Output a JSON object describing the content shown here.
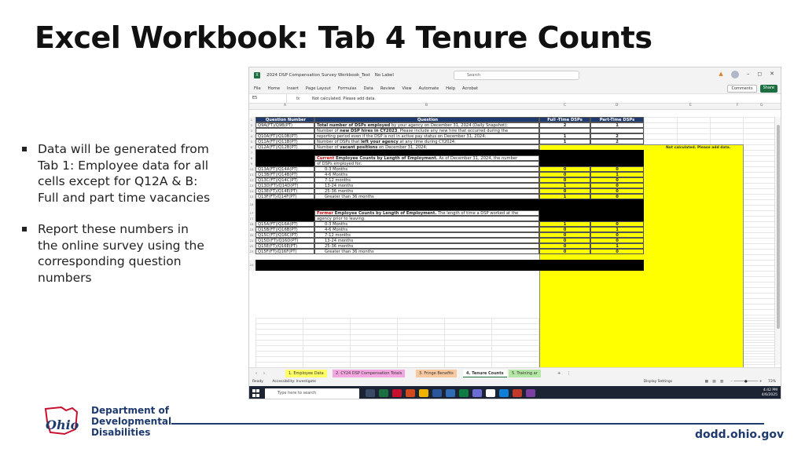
{
  "slide": {
    "title": "Excel Workbook: Tab 4 Tenure Counts",
    "bullets": [
      "Data will be generated from Tab 1: Employee data for all cells except for Q12A & B: Full and part time vacancies",
      "Report these numbers in the online survey using the corresponding question numbers"
    ]
  },
  "excel": {
    "file_title": "2024 DSP Compensation Survey Workbook_Test",
    "label": "No Label",
    "search_placeholder": "Search",
    "menu": [
      "File",
      "Home",
      "Insert",
      "Page Layout",
      "Formulas",
      "Data",
      "Review",
      "View",
      "Automate",
      "Help",
      "Acrobat"
    ],
    "comments_label": "Comments",
    "share_label": "Share",
    "name_box": "E5",
    "formula_value": "Not calculated. Please add data.",
    "columns": [
      "A",
      "B",
      "C",
      "D",
      "E",
      "F",
      "G"
    ],
    "header": {
      "q": "Question Number",
      "question": "Question",
      "ft": "Full -Time DSPs",
      "pt": "Part-Time DSPs"
    },
    "rows1": [
      {
        "rn": "2",
        "q": "Q9A(FT)/Q9B(PT)",
        "pre": "",
        "bold": "Total number of DSPs employed",
        "post": " by your agency on December 31, 2024 (Daily Snapshot):",
        "ft": "2",
        "pt": "1"
      },
      {
        "rn": "3",
        "q": "",
        "pre": "Number of ",
        "bold": "new DSP hires in CY2023",
        "post": ". Please include any new hire that occurred during the",
        "ft": "",
        "pt": ""
      },
      {
        "rn": "4",
        "q": "Q10A(FT)/Q10B(PT)",
        "pre": "reporting period even if the DSP is not in active pay status on December 31, 2024:",
        "bold": "",
        "post": "",
        "ft": "1",
        "pt": "2"
      },
      {
        "rn": "5",
        "q": "Q11A(FT)/Q11B(PT)",
        "pre": "Number of DSPs that ",
        "bold": "left your agency",
        "post": " at any time during CY2024:",
        "ft": "1",
        "pt": "2"
      },
      {
        "rn": "6",
        "q": "Q12A(FT)/Q12B(PT)",
        "pre": "Number of ",
        "bold": "vacant positions",
        "post": " on December 31, 2024:",
        "ft": "",
        "pt": ""
      }
    ],
    "vacant_note": "Not calculated. Please add data.",
    "current_heading": {
      "red": "Current",
      "bold": " Employee Counts by Length of Employment.",
      "post": " As of December 31, 2024, the number",
      "line2": "of DSPs employed for:"
    },
    "current_rows": [
      {
        "rn": "10",
        "q": "Q13A(FT)/Q14A(PT)",
        "label": "0-3 Months",
        "ft": "0",
        "pt": "0"
      },
      {
        "rn": "11",
        "q": "Q13B(FT)/Q14B(PT)",
        "label": "4-6 Months",
        "ft": "0",
        "pt": "1"
      },
      {
        "rn": "12",
        "q": "Q13C(FT)/Q14C(PT)",
        "label": "7-12 months",
        "ft": "0",
        "pt": "0"
      },
      {
        "rn": "13",
        "q": "Q13D(FT)/Q14D(PT)",
        "label": "13-24 months",
        "ft": "1",
        "pt": "0"
      },
      {
        "rn": "14",
        "q": "Q13E(FT)/Q14E(PT)",
        "label": "25-36 months",
        "ft": "0",
        "pt": "0"
      },
      {
        "rn": "15",
        "q": "Q13F(FT)/Q14F(PT)",
        "label": "Greater than 36 months",
        "ft": "1",
        "pt": "0"
      }
    ],
    "former_heading": {
      "red": "Former",
      "bold": " Employee Counts by Length of Employment.",
      "post": " The length of time a DSP worked at the",
      "line2": "agency prior to leaving:"
    },
    "former_rows": [
      {
        "rn": "18",
        "q": "Q15A(FT)/Q16A(PT)",
        "label": "0-3 Months",
        "ft": "1",
        "pt": "0"
      },
      {
        "rn": "19",
        "q": "Q15B(FT)/Q16B(PT)",
        "label": "4-6 Months",
        "ft": "0",
        "pt": "1"
      },
      {
        "rn": "20",
        "q": "Q15C(FT)/Q16C(PT)",
        "label": "7-12 months",
        "ft": "0",
        "pt": "0"
      },
      {
        "rn": "21",
        "q": "Q15D(FT)/Q16D(PT)",
        "label": "13-24 months",
        "ft": "0",
        "pt": "0"
      },
      {
        "rn": "22",
        "q": "Q15E(FT)/Q16E(PT)",
        "label": "25-36 months",
        "ft": "0",
        "pt": "1"
      },
      {
        "rn": "23",
        "q": "Q15F(FT)/Q16F(PT)",
        "label": "Greater than 36 months",
        "ft": "0",
        "pt": "0"
      }
    ],
    "sheet_tabs": [
      {
        "label": "1. Employee Data",
        "color": "#ffff66"
      },
      {
        "label": "2. CY24 DSP Compensation Totals",
        "color": "#f4a6e0"
      },
      {
        "label": "3. Fringe Benefits",
        "color": "#f8c9a0"
      },
      {
        "label": "4. Tenure Counts",
        "color": "#ffffff"
      },
      {
        "label": "5. Training ar",
        "color": "#b6e6a6"
      }
    ],
    "status_left": "Ready",
    "accessibility": "Accessibility: Investigate",
    "display_settings": "Display Settings",
    "zoom": "73%",
    "taskbar_search": "Type here to search",
    "clock_time": "4:42 PM",
    "clock_date": "4/6/2025"
  },
  "footer": {
    "dept_line1": "Department of",
    "dept_line2": "Developmental",
    "dept_line3": "Disabilities",
    "logo_text": "Ohio",
    "website": "dodd.ohio.gov"
  },
  "colors": {
    "brand_blue": "#1f3a6e",
    "excel_green": "#1d6f42",
    "ohio_red": "#c8102e",
    "highlight_yellow": "#ffff00"
  }
}
